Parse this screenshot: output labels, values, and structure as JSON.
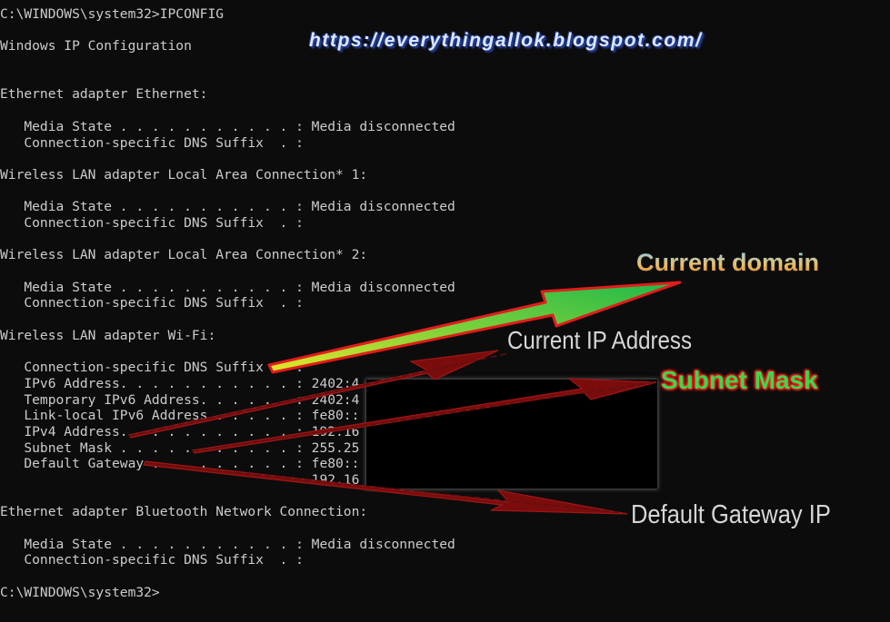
{
  "terminal": {
    "lines": [
      "C:\\WINDOWS\\system32>IPCONFIG",
      "",
      "Windows IP Configuration",
      "",
      "",
      "Ethernet adapter Ethernet:",
      "",
      "   Media State . . . . . . . . . . . : Media disconnected",
      "   Connection-specific DNS Suffix  . :",
      "",
      "Wireless LAN adapter Local Area Connection* 1:",
      "",
      "   Media State . . . . . . . . . . . : Media disconnected",
      "   Connection-specific DNS Suffix  . :",
      "",
      "Wireless LAN adapter Local Area Connection* 2:",
      "",
      "   Media State . . . . . . . . . . . : Media disconnected",
      "   Connection-specific DNS Suffix  . :",
      "",
      "Wireless LAN adapter Wi-Fi:",
      "",
      "   Connection-specific DNS Suffix  . :",
      "   IPv6 Address. . . . . . . . . . . : 2402:4",
      "   Temporary IPv6 Address. . . . . . : 2402:4",
      "   Link-local IPv6 Address . . . . . : fe80::",
      "   IPv4 Address. . . . . . . . . . . : 192.16",
      "   Subnet Mask . . . . . . . . . . . : 255.25",
      "   Default Gateway . . . . . . . . . : fe80::",
      "                                       192.16",
      "",
      "Ethernet adapter Bluetooth Network Connection:",
      "",
      "   Media State . . . . . . . . . . . : Media disconnected",
      "   Connection-specific DNS Suffix  . :",
      "",
      "C:\\WINDOWS\\system32>"
    ]
  },
  "watermark": "https://everythingallok.blogspot.com/",
  "annotations": {
    "current_domain": "Current domain",
    "current_ip": "Current IP Address",
    "subnet_mask": "Subnet Mask",
    "default_gateway": "Default Gateway IP"
  },
  "colors": {
    "background": "#0c0c0c",
    "text": "#cccccc",
    "arrow_red": "#8b0f0f",
    "arrow_green": "#1fb84a",
    "arrow_yellow": "#e6e62a"
  }
}
